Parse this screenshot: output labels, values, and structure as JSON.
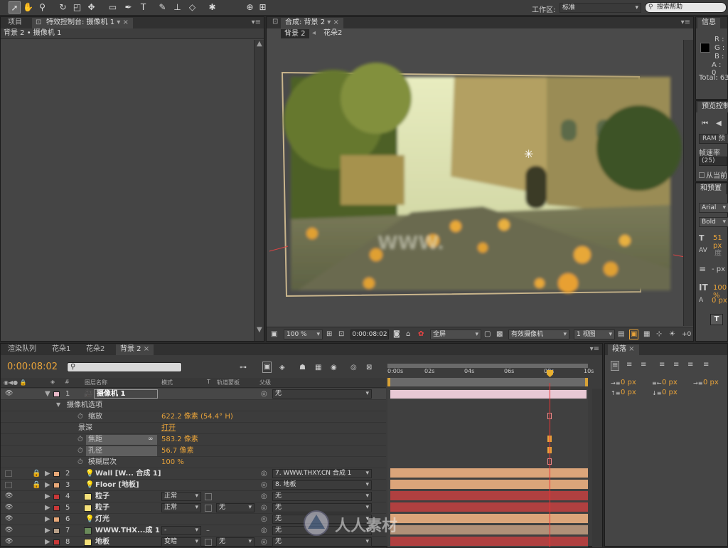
{
  "toolbar": {
    "workspace_label": "工作区:",
    "workspace_value": "标准",
    "search_placeholder": "搜索帮助"
  },
  "left_panel": {
    "tab_project": "项目",
    "tab_effects": "特效控制台: 摄像机 1",
    "breadcrumb": "背景 2 • 摄像机 1"
  },
  "comp_panel": {
    "tab_label": "合成: 背景 2",
    "crumb_1": "背景 2",
    "crumb_2": "花朵2",
    "watermark_text": "WWW.",
    "zoom": "100 %",
    "timecode": "0:00:08:02",
    "resolution": "全屏",
    "camera": "有效摄像机",
    "view": "1 视图",
    "offset": "+0"
  },
  "info_panel": {
    "tab": "信息",
    "r": "R :",
    "g": "G :",
    "b": "B :",
    "a": "A : 0",
    "total": "Total: 63"
  },
  "preview_panel": {
    "tab": "预览控制",
    "ram": "RAM 预",
    "framerate_label": "帧速率",
    "framerate_value": "(25)",
    "from_current": "从当前"
  },
  "char_panel": {
    "tab": "和预置",
    "font": "Arial",
    "style": "Bold",
    "size": "51 px",
    "tracking_unit": "度",
    "stroke": "- px",
    "scale": "100 %",
    "baseline": "0 px",
    "t_button": "T"
  },
  "timeline": {
    "tabs": [
      "渲染队列",
      "花朵1",
      "花朵2",
      "背景 2"
    ],
    "timecode": "0:00:08:02",
    "col_name": "图层名称",
    "col_mode": "模式",
    "col_t": "T",
    "col_trkmat": "轨道蒙板",
    "col_parent": "父级",
    "col_hash": "#",
    "ruler": [
      "0:00s",
      "02s",
      "04s",
      "06s",
      "08s",
      "10s"
    ],
    "camera_options_label": "摄像机选项",
    "props": [
      {
        "name": "缩放",
        "value": "622.2 像素 (54.4° H)"
      },
      {
        "name": "景深",
        "value": "打开"
      },
      {
        "name": "焦距",
        "value": "583.2 像素"
      },
      {
        "name": "孔径",
        "value": "56.7 像素"
      },
      {
        "name": "模糊层次",
        "value": "100 %"
      }
    ],
    "layers": [
      {
        "num": "1",
        "name": "摄像机 1",
        "mode": "",
        "trkmat": "",
        "parent": "无",
        "color": "#e8b8c8"
      },
      {
        "num": "2",
        "name": "Wall [W... 合成 1]",
        "mode": "",
        "trkmat": "",
        "parent": "7. WWW.THXY.CN 合成 1",
        "color": "#e8a878"
      },
      {
        "num": "3",
        "name": "Floor [地板]",
        "mode": "",
        "trkmat": "",
        "parent": "8. 地板",
        "color": "#e8a878"
      },
      {
        "num": "4",
        "name": "粒子",
        "mode": "正常",
        "trkmat": "",
        "parent": "无",
        "color": "#c83838"
      },
      {
        "num": "5",
        "name": "粒子",
        "mode": "正常",
        "trkmat": "无",
        "parent": "无",
        "color": "#c83838"
      },
      {
        "num": "6",
        "name": "灯光",
        "mode": "",
        "trkmat": "",
        "parent": "无",
        "color": "#e8a878"
      },
      {
        "num": "7",
        "name": "WWW.THX...成 1",
        "mode": "-",
        "trkmat": "",
        "parent": "无",
        "color": "#b8a088"
      },
      {
        "num": "8",
        "name": "地板",
        "mode": "变暗",
        "trkmat": "无",
        "parent": "无",
        "color": "#c83838"
      }
    ]
  },
  "paragraph_panel": {
    "tab": "段落",
    "fields": [
      "0 px",
      "0 px",
      "0 px",
      "0 px",
      "0 px"
    ]
  },
  "site_watermark": "人人素材"
}
